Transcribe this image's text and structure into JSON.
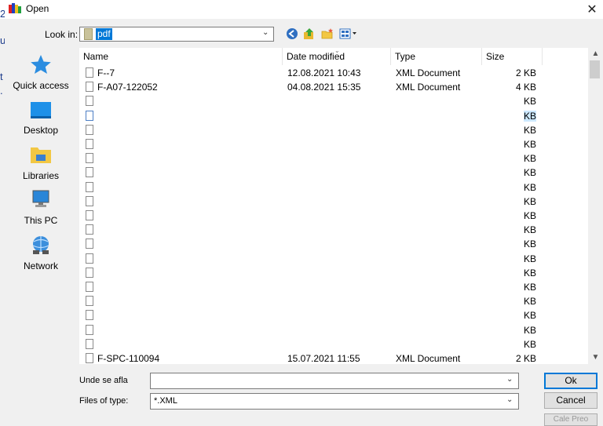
{
  "window": {
    "title": "Open",
    "close_glyph": "✕"
  },
  "background_slivers": [
    "2",
    "u",
    "t",
    "."
  ],
  "lookin": {
    "label": "Look in:",
    "value": "pdf"
  },
  "toolbar": {
    "icons": [
      "back-icon",
      "up-folder-icon",
      "new-folder-icon",
      "view-menu-icon"
    ]
  },
  "places": [
    {
      "label": "Quick access",
      "icon": "star-icon"
    },
    {
      "label": "Desktop",
      "icon": "desktop-icon"
    },
    {
      "label": "Libraries",
      "icon": "libraries-icon"
    },
    {
      "label": "This PC",
      "icon": "computer-icon"
    },
    {
      "label": "Network",
      "icon": "network-icon"
    }
  ],
  "columns": {
    "name": "Name",
    "date": "Date modified",
    "type": "Type",
    "size": "Size"
  },
  "files": [
    {
      "name": "F--7",
      "date": "12.08.2021 10:43",
      "type": "XML Document",
      "size": "2 KB"
    },
    {
      "name": "F-A07-122052",
      "date": "04.08.2021 15:35",
      "type": "XML Document",
      "size": "4 KB"
    },
    {
      "name": "",
      "date": "",
      "type": "",
      "size": "KB"
    },
    {
      "name": "",
      "date": "",
      "type": "",
      "size": "KB"
    },
    {
      "name": "",
      "date": "",
      "type": "",
      "size": "KB"
    },
    {
      "name": "",
      "date": "",
      "type": "",
      "size": "KB"
    },
    {
      "name": "",
      "date": "",
      "type": "",
      "size": "KB"
    },
    {
      "name": "",
      "date": "",
      "type": "",
      "size": "KB"
    },
    {
      "name": "",
      "date": "",
      "type": "",
      "size": "KB"
    },
    {
      "name": "",
      "date": "",
      "type": "",
      "size": "KB"
    },
    {
      "name": "",
      "date": "",
      "type": "",
      "size": "KB"
    },
    {
      "name": "",
      "date": "",
      "type": "",
      "size": "KB"
    },
    {
      "name": "",
      "date": "",
      "type": "",
      "size": "KB"
    },
    {
      "name": "",
      "date": "",
      "type": "",
      "size": "KB"
    },
    {
      "name": "",
      "date": "",
      "type": "",
      "size": "KB"
    },
    {
      "name": "",
      "date": "",
      "type": "",
      "size": "KB"
    },
    {
      "name": "",
      "date": "",
      "type": "",
      "size": "KB"
    },
    {
      "name": "",
      "date": "",
      "type": "",
      "size": "KB"
    },
    {
      "name": "",
      "date": "",
      "type": "",
      "size": "KB"
    },
    {
      "name": "",
      "date": "",
      "type": "",
      "size": "KB"
    },
    {
      "name": "F-SPC-110094",
      "date": "15.07.2021 11:55",
      "type": "XML Document",
      "size": "2 KB"
    }
  ],
  "selected_row": 3,
  "filename": {
    "label": "Unde se afla",
    "value": ""
  },
  "filetype": {
    "label": "Files of type:",
    "value": "*.XML"
  },
  "buttons": {
    "ok": "Ok",
    "cancel": "Cancel",
    "third": "Cale Preo"
  }
}
